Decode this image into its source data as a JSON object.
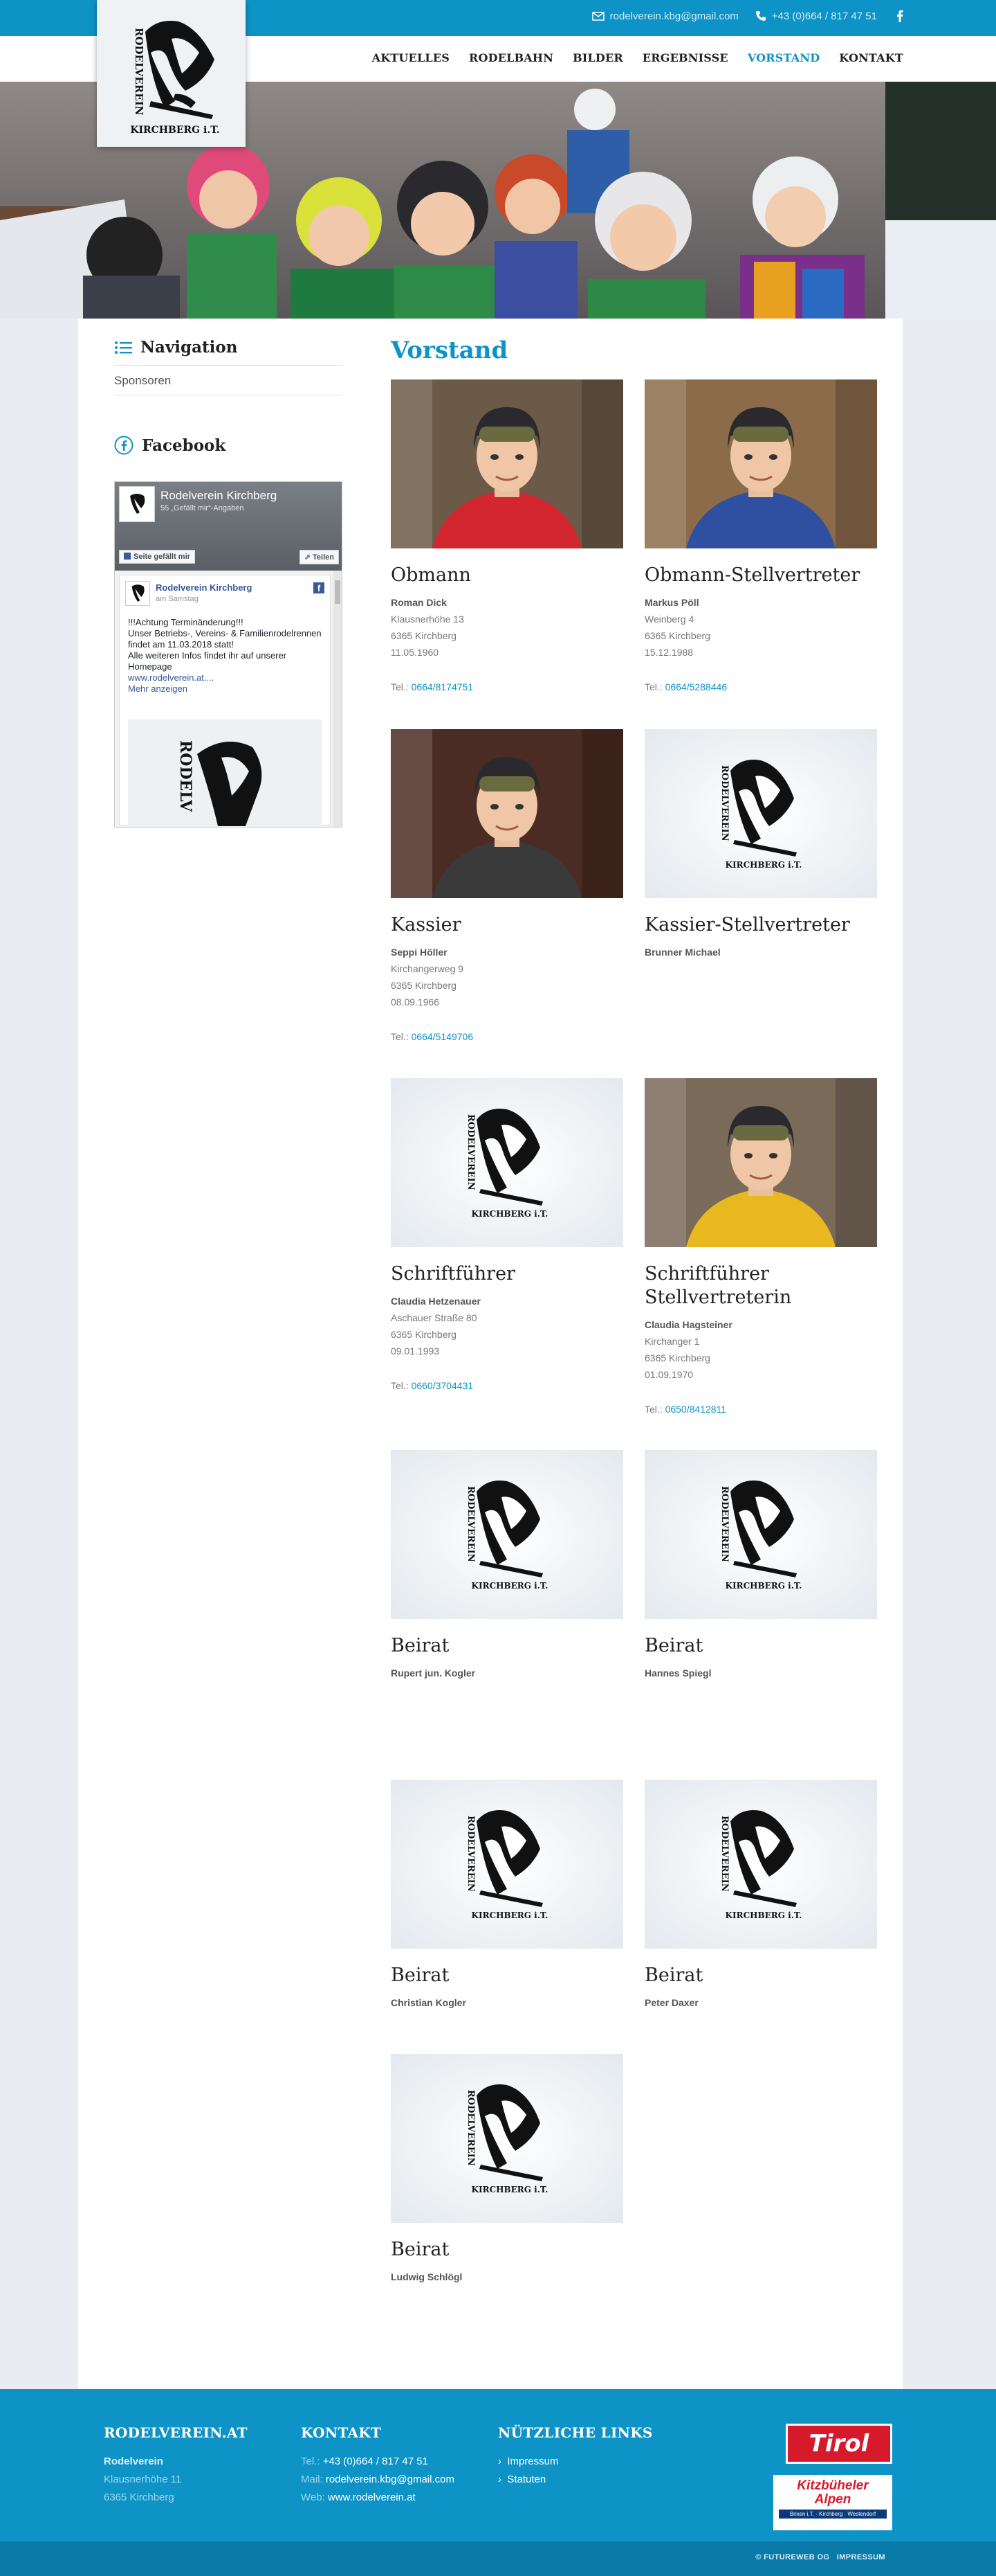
{
  "topbar": {
    "email": "rodelverein.kbg@gmail.com",
    "phone": "+43 (0)664 / 817 47 51",
    "facebook_icon": "facebook-icon"
  },
  "logo": {
    "text_vertical": "RODELVEREIN",
    "text_bottom": "KIRCHBERG i.T."
  },
  "nav": {
    "items": [
      {
        "label": "AKTUELLES",
        "active": false
      },
      {
        "label": "RODELBAHN",
        "active": false
      },
      {
        "label": "BILDER",
        "active": false
      },
      {
        "label": "ERGEBNISSE",
        "active": false
      },
      {
        "label": "VORSTAND",
        "active": true
      },
      {
        "label": "KONTAKT",
        "active": false
      }
    ]
  },
  "sidebar": {
    "nav_title": "Navigation",
    "nav_link": "Sponsoren",
    "fb_title": "Facebook",
    "fb_widget": {
      "page_name": "Rodelverein Kirchberg",
      "likes": "55 „Gefällt mir“-Angaben",
      "like_btn": "Seite gefällt mir",
      "share_btn": "Teilen",
      "post_author": "Rodelverein Kirchberg",
      "post_date": "am Samstag",
      "post_text_1": "!!!Achtung Terminänderung!!!",
      "post_text_2": "Unser Betriebs-, Vereins- & Familienrodelrennen findet am 11.03.2018 statt!",
      "post_text_3": "Alle weiteren Infos findet ihr auf unserer Homepage",
      "post_link": "www.rodelverein.at....",
      "more": "Mehr anzeigen"
    }
  },
  "main": {
    "title": "Vorstand",
    "tel_prefix": "Tel.:",
    "members": [
      {
        "role": "Obmann",
        "name": "Roman Dick",
        "street": "Klausnerhöhe 13",
        "city": "6365 Kirchberg",
        "dob": "11.05.1960",
        "tel": "0664/8174751",
        "photo": "photo"
      },
      {
        "role": "Obmann-Stellvertreter",
        "name": "Markus Pöll",
        "street": "Weinberg 4",
        "city": "6365 Kirchberg",
        "dob": "15.12.1988",
        "tel": "0664/5288446",
        "photo": "photo"
      },
      {
        "role": "Kassier",
        "name": "Seppi Höller",
        "street": "Kirchangerweg 9",
        "city": "6365 Kirchberg",
        "dob": "08.09.1966",
        "tel": "0664/5149706",
        "photo": "photo"
      },
      {
        "role": "Kassier-Stellvertreter",
        "name": "Brunner Michael",
        "photo": "logo"
      },
      {
        "role": "Schriftführer",
        "name": "Claudia Hetzenauer",
        "street": "Aschauer Straße 80",
        "city": "6365 Kirchberg",
        "dob": "09.01.1993",
        "tel": "0660/3704431",
        "photo": "logo"
      },
      {
        "role": "Schriftführer Stellvertreterin",
        "name": "Claudia Hagsteiner",
        "street": "Kirchanger 1",
        "city": "6365 Kirchberg",
        "dob": "01.09.1970",
        "tel": "0650/8412811",
        "photo": "photo"
      },
      {
        "role": "Beirat",
        "name": "Rupert jun. Kogler",
        "photo": "logo"
      },
      {
        "role": "Beirat",
        "name": "Hannes Spiegl",
        "photo": "logo"
      },
      {
        "role": "Beirat",
        "name": "Christian Kogler",
        "photo": "logo"
      },
      {
        "role": "Beirat",
        "name": "Peter Daxer",
        "photo": "logo"
      },
      {
        "role": "Beirat",
        "name": "Ludwig Schlögl",
        "photo": "logo"
      }
    ]
  },
  "footer": {
    "col1_title": "RODELVEREIN.AT",
    "col1_name": "Rodelverein",
    "col1_street": "Klausnerhöhe 11",
    "col1_city": "6365 Kirchberg",
    "col2_title": "KONTAKT",
    "tel_label": "Tel.:",
    "tel": "+43 (0)664 / 817 47 51",
    "mail_label": "Mail:",
    "mail": "rodelverein.kbg@gmail.com",
    "web_label": "Web:",
    "web": "www.rodelverein.at",
    "col3_title": "NÜTZLICHE LINKS",
    "links": [
      "Impressum",
      "Statuten"
    ],
    "tirol": "Tirol",
    "kitz_1": "Kitzbüheler",
    "kitz_2": "Alpen",
    "kitz_3": "Brixen i.T. · Kirchberg · Westendorf"
  },
  "subfooter": {
    "credit": "© FUTUREWEB OG",
    "impressum": "IMPRESSUM"
  },
  "colors": {
    "accent": "#0e93c7",
    "footer_dark": "#0a7aa8",
    "tirol_red": "#d7192c"
  }
}
